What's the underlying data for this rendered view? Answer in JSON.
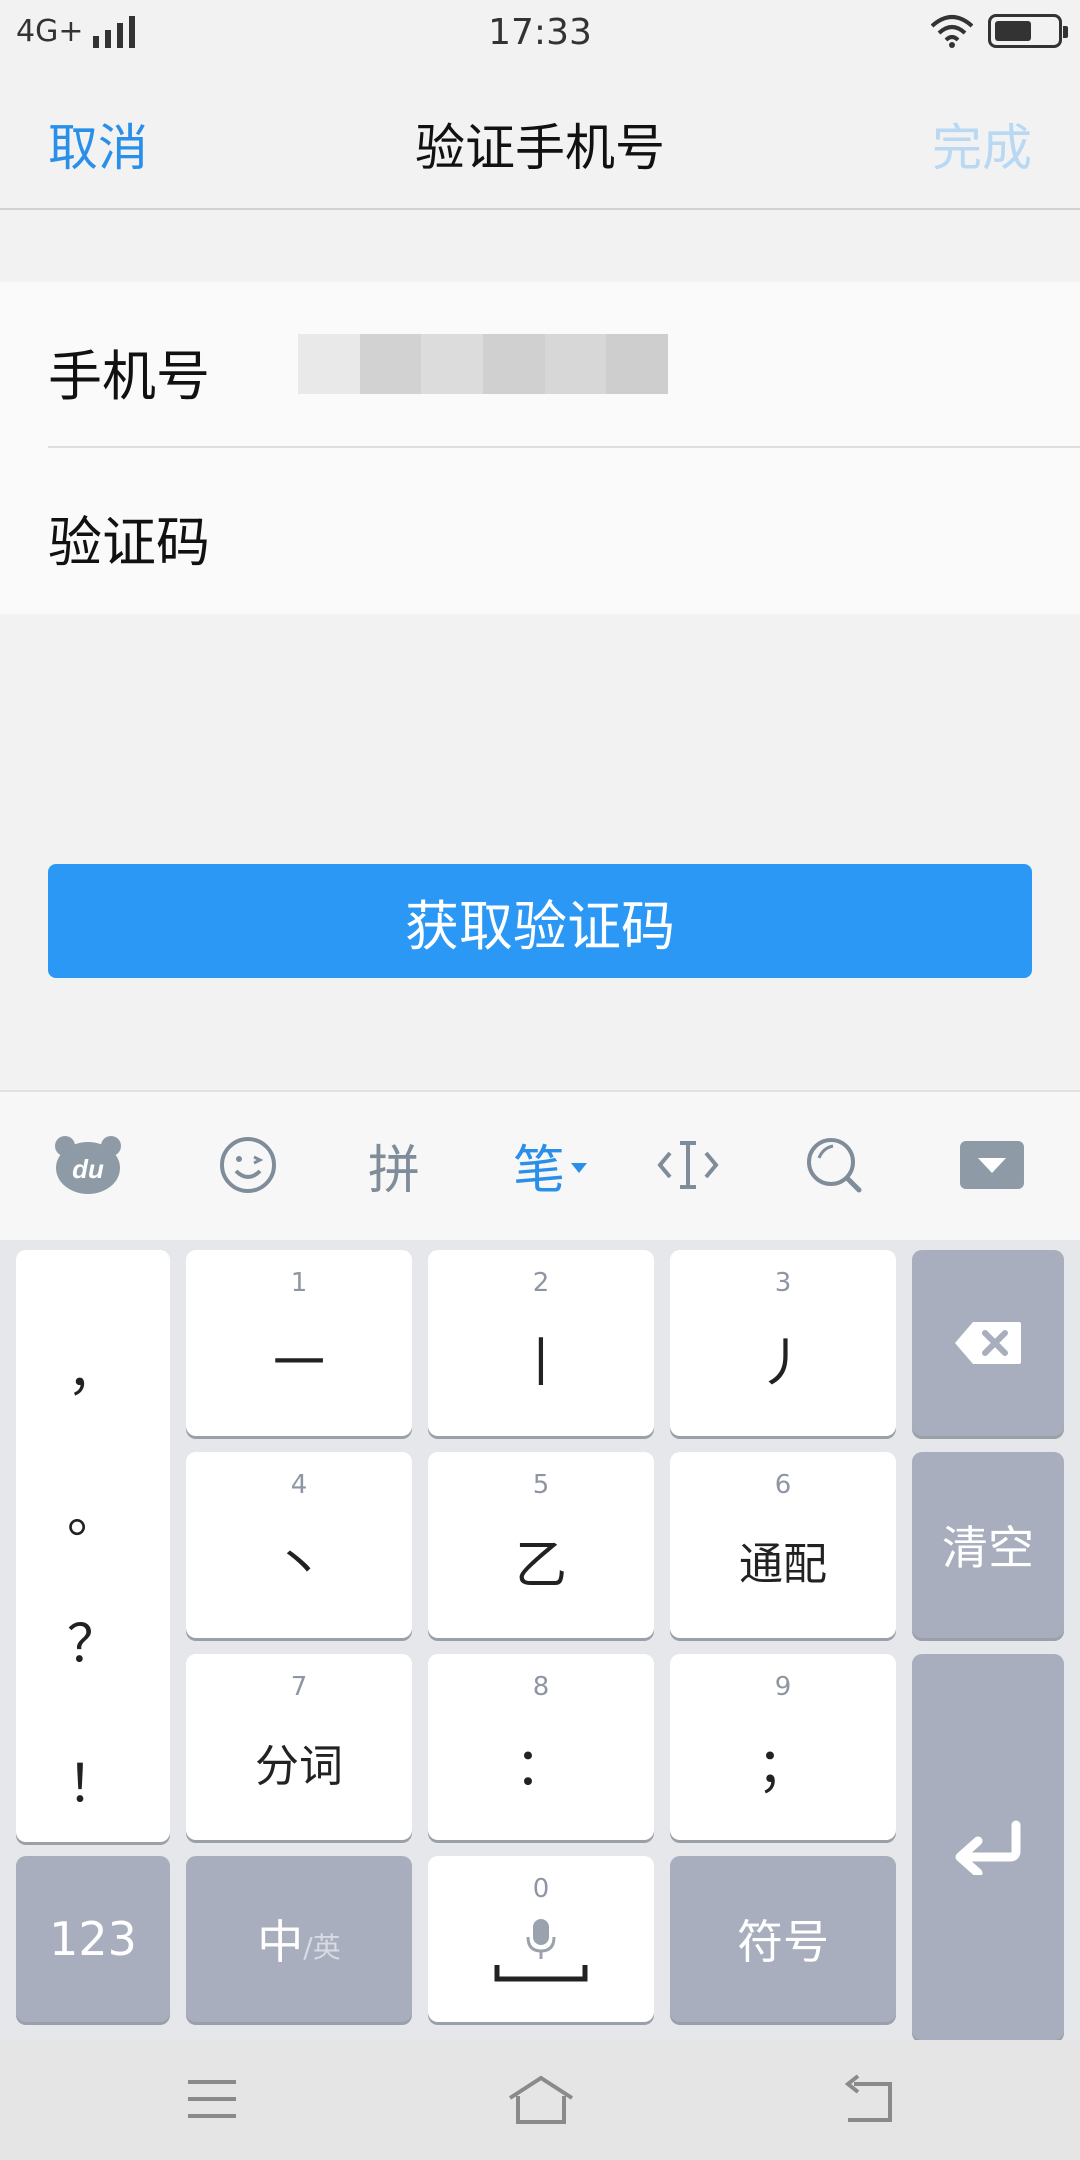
{
  "status_bar": {
    "network": "4G+",
    "time": "17:33"
  },
  "nav": {
    "cancel": "取消",
    "title": "验证手机号",
    "done": "完成"
  },
  "form": {
    "phone_label": "手机号",
    "code_label": "验证码"
  },
  "get_code_button": "获取验证码",
  "toolbar": {
    "pinyin": "拼",
    "stroke": "笔",
    "icons": [
      "du-bear-icon",
      "emoji-icon",
      "cursor-icon",
      "search-icon",
      "collapse-keyboard-icon"
    ]
  },
  "keyboard": {
    "punctuation": [
      "，",
      "。",
      "？",
      "！"
    ],
    "keys": [
      {
        "num": "1",
        "label": "一"
      },
      {
        "num": "2",
        "label": "丨"
      },
      {
        "num": "3",
        "label": "丿"
      },
      {
        "num": "4",
        "label": "丶"
      },
      {
        "num": "5",
        "label": "乙"
      },
      {
        "num": "6",
        "label": "通配"
      },
      {
        "num": "7",
        "label": "分词"
      },
      {
        "num": "8",
        "label": "："
      },
      {
        "num": "9",
        "label": "；"
      }
    ],
    "clear": "清空",
    "num_mode": "123",
    "lang_main": "中",
    "lang_sub": "/英",
    "space_num": "0",
    "symbols": "符号"
  },
  "colors": {
    "accent": "#2a8fe8",
    "button": "#2b98f5",
    "done_disabled": "#b8d8f4",
    "function_key": "#a8aebd"
  }
}
